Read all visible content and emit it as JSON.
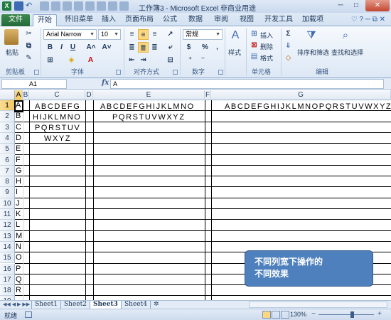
{
  "window": {
    "title": "工作簿3 - Microsoft Excel 非商业用途",
    "app_logo": "X",
    "undo_glyph": "↶",
    "controls": {
      "minimize": "─",
      "maximize": "□",
      "close": "✕"
    }
  },
  "ribbon_tabs": [
    "文件",
    "开始",
    "怀旧菜单",
    "插入",
    "页面布局",
    "公式",
    "数据",
    "审阅",
    "视图",
    "开发工具",
    "加载项"
  ],
  "help_glyphs": "♡ ? ─ ⧉ ✕",
  "ribbon": {
    "clipboard": {
      "paste_label": "粘贴",
      "group": "剪贴板"
    },
    "font": {
      "family": "Arial Narrow",
      "size": "10",
      "bold": "B",
      "italic": "I",
      "underline": "U",
      "grow": "A˄",
      "shrink": "A˅",
      "group": "字体"
    },
    "alignment": {
      "group": "对齐方式"
    },
    "number": {
      "format": "常规",
      "currency": "$",
      "percent": "%",
      "comma": ",",
      "group": "数字"
    },
    "styles": {
      "label": "样式"
    },
    "cells": {
      "insert": "插入",
      "delete": "删除",
      "format": "格式",
      "group": "单元格"
    },
    "editing": {
      "sum": "Σ",
      "sort_filter": "排序和筛选",
      "find_select": "查找和选择",
      "group": "编辑"
    }
  },
  "formula_bar": {
    "name_box": "A1",
    "fx": "fx",
    "content": "A"
  },
  "columns": [
    "A",
    "B",
    "C",
    "D",
    "E",
    "F",
    "G"
  ],
  "rows": [
    "1",
    "2",
    "3",
    "4",
    "5",
    "6",
    "7",
    "8",
    "9",
    "10",
    "11",
    "12",
    "13",
    "14",
    "15",
    "16",
    "17",
    "18",
    "19"
  ],
  "col_a_cells": [
    "A",
    "B",
    "C",
    "D",
    "E",
    "F",
    "G",
    "H",
    "I",
    "J",
    "K",
    "L",
    "M",
    "N",
    "O",
    "P",
    "Q",
    "R"
  ],
  "col_c_cells": [
    "ABCDEFG",
    "HIJKLMNO",
    "PQRSTUV",
    "WXYZ"
  ],
  "col_e_cells": [
    "ABCDEFGHIJKLMNO",
    "PQRSTUVWXYZ"
  ],
  "col_g_cells": [
    "ABCDEFGHIJKLMNOPQRSTUVWXYZ"
  ],
  "callout": {
    "line1": "不同列宽下操作的",
    "line2": "不同效果"
  },
  "sheet_nav": "◀◀ ◀ ▶ ▶▶",
  "sheets": [
    "Sheet1",
    "Sheet2",
    "Sheet3",
    "Sheet4"
  ],
  "new_sheet_glyph": "✲",
  "status": {
    "mode": "就绪",
    "zoom": "130%",
    "zoom_minus": "−",
    "zoom_plus": "+",
    "zoom_level": 0.6
  }
}
